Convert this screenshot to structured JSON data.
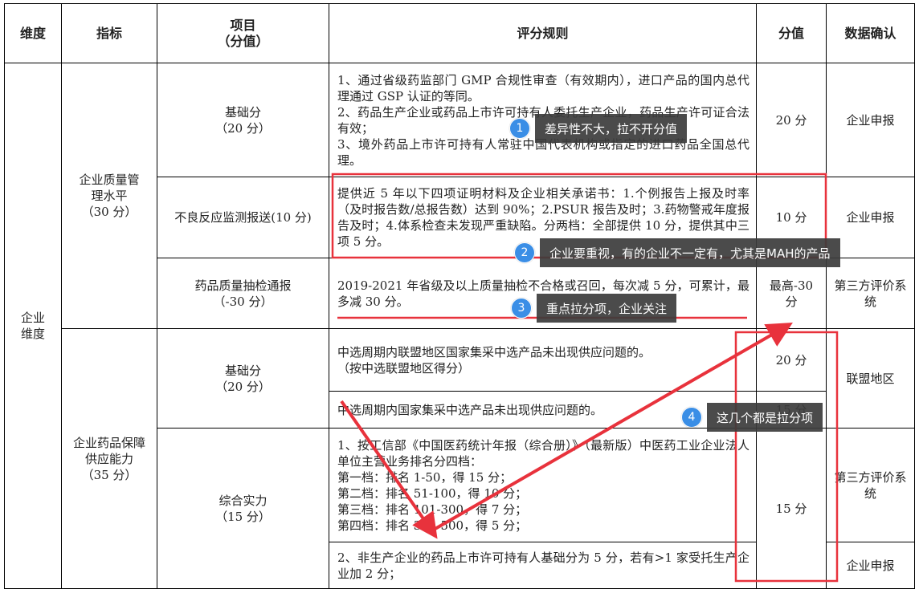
{
  "headers": {
    "dimension": "维度",
    "indicator": "指标",
    "item": "项目",
    "item_sub": "（分值）",
    "rule": "评分规则",
    "score": "分值",
    "confirm": "数据确认"
  },
  "dimension": "企业维度",
  "groups": [
    {
      "indicator": "企业质量管理水平",
      "indicator_score": "（30 分）"
    },
    {
      "indicator": "企业药品保障供应能力",
      "indicator_score": "（35 分）"
    }
  ],
  "rows": [
    {
      "item": "基础分",
      "item_score": "（20 分）",
      "rules": [
        "1、通过省级药监部门 GMP 合规性审查（有效期内），进口产品的国内总代理通过 GSP 认证的等同。",
        "2、药品生产企业或药品上市许可持有人委托生产企业，药品生产许可证合法有效；",
        "3、境外药品上市许可持有人常驻中国代表机构或指定的进口药品全国总代理。"
      ],
      "score": "20 分",
      "confirm": "企业申报"
    },
    {
      "item": "不良反应监测报送(10 分)",
      "rules": [
        "提供近 5 年以下四项证明材料及企业相关承诺书：1.个例报告上报及时率（及时报告数/总报告数）达到 90%；2.PSUR 报告及时；3.药物警戒年度报告及时；4.体系检查未发现严重缺陷。分两档：全部提供 10 分，提供其中三项 5 分。"
      ],
      "score": "10 分",
      "confirm": "企业申报"
    },
    {
      "item": "药品质量抽检通报",
      "item_score": "（-30 分）",
      "rules": [
        "2019-2021 年省级及以上质量抽检不合格或召回，每次减 5 分，可累计，最多减 30 分。"
      ],
      "score": "最高-30 分",
      "confirm": "第三方评价系统"
    },
    {
      "item": "基础分",
      "item_score": "（20 分）",
      "rules_a": [
        "中选周期内联盟地区国家集采中选产品未出现供应问题的。",
        "（按中选联盟地区得分）"
      ],
      "score_a": "20 分",
      "rules_b": [
        "中选周期内国家集采中选产品未出现供应问题的。"
      ],
      "score_b": "15 分",
      "confirm": "联盟地区"
    },
    {
      "item": "综合实力",
      "item_score": "（15 分）",
      "rules_a": [
        "1、按工信部《中国医药统计年报（综合册）》（最新版）中医药工业企业法人单位主营业务排名分四档：",
        "第一档：排名 1-50，得 15 分；",
        "第二档：排名 51-100，得 10 分；",
        "第三档：排名 101-300，得 7 分；",
        "第四档：排名 301-500，得 5 分；"
      ],
      "confirm_a": "第三方评价系统",
      "rules_b": [
        "2、非生产企业的药品上市许可持有人基础分为 5 分，若有>1 家受托生产企业加 2 分；"
      ],
      "confirm_b": "企业申报",
      "score": "15 分"
    }
  ],
  "callouts": [
    {
      "num": "1",
      "text": "差异性不大，拉不开分值"
    },
    {
      "num": "2",
      "text": "企业要重视，有的企业不一定有，尤其是MAH的产品"
    },
    {
      "num": "3",
      "text": "重点拉分项，企业关注"
    },
    {
      "num": "4",
      "text": "这几个都是拉分项"
    }
  ],
  "annotation_color": "#e8323c",
  "badge_color": "#3a8ee6"
}
